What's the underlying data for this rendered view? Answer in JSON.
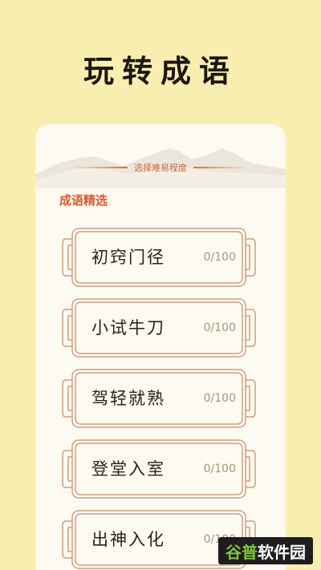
{
  "header": {
    "title": "玩转成语"
  },
  "card": {
    "subtitle": "选择难易程度",
    "section_label": "成语精选",
    "levels": [
      {
        "name": "初窍门径",
        "progress": "0/100"
      },
      {
        "name": "小试牛刀",
        "progress": "0/100"
      },
      {
        "name": "驾轻就熟",
        "progress": "0/100"
      },
      {
        "name": "登堂入室",
        "progress": "0/100"
      },
      {
        "name": "出神入化",
        "progress": "0/100"
      }
    ]
  },
  "watermark": {
    "part1": "谷普",
    "part2": "软件园"
  },
  "colors": {
    "background": "#f8eeb0",
    "card": "#fdfaf2",
    "accent": "#d9572e",
    "frame": "#cf9e7e"
  }
}
